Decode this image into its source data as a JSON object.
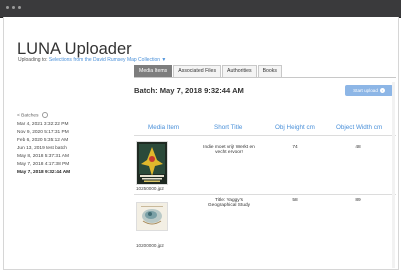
{
  "window": {
    "title_dots": 3
  },
  "app": {
    "title": "LUNA Uploader",
    "subtitle_prefix": "Uploading to:",
    "collection_link": "Selections from the David Rumsey Map Collection",
    "collection_chevron": "▼"
  },
  "tabs": [
    {
      "label": "Media Items",
      "active": true
    },
    {
      "label": "Associated Files",
      "active": false
    },
    {
      "label": "Authorities",
      "active": false
    },
    {
      "label": "Books",
      "active": false
    }
  ],
  "batch": {
    "heading": "Batch: May 7, 2018 9:32:44 AM",
    "start_upload_label": "Start upload",
    "start_upload_icon": "arrow-right-icon"
  },
  "sidebar": {
    "toggle_label": "< Batches",
    "toggle_icon": "chevron-icon",
    "items": [
      {
        "label": "Mar 4, 2021 3:32:22 PM"
      },
      {
        "label": "Nov 9, 2020 5:17:31 PM"
      },
      {
        "label": "Feb 6, 2020 5:35:12 AM"
      },
      {
        "label": "Jun 13, 2019 test batch"
      },
      {
        "label": "May 8, 2018 5:37:31 AM"
      },
      {
        "label": "May 7, 2018 4:17:38 PM"
      },
      {
        "label": "May 7, 2018 9:32:44 AM",
        "selected": true
      }
    ]
  },
  "table": {
    "columns": [
      "Media Item",
      "Short Title",
      "Obj Height cm",
      "Object Width cm"
    ],
    "rows": [
      {
        "filename": "10250000.jp2",
        "thumb_icon": "poster-thumbnail",
        "short_title": "Indie moet vrij! Werkt en vecht ervoor!",
        "height": "74",
        "width": "48"
      },
      {
        "filename": "10200000.jp2",
        "thumb_icon": "map-thumbnail",
        "short_title": "Title: Yaggy's Geographical Study",
        "height": "58",
        "width": "89"
      }
    ]
  },
  "colors": {
    "accent": "#4a90d9",
    "button": "#8db6e6",
    "active_tab": "#7d7d7d",
    "titlebar": "#3a3a3c"
  }
}
